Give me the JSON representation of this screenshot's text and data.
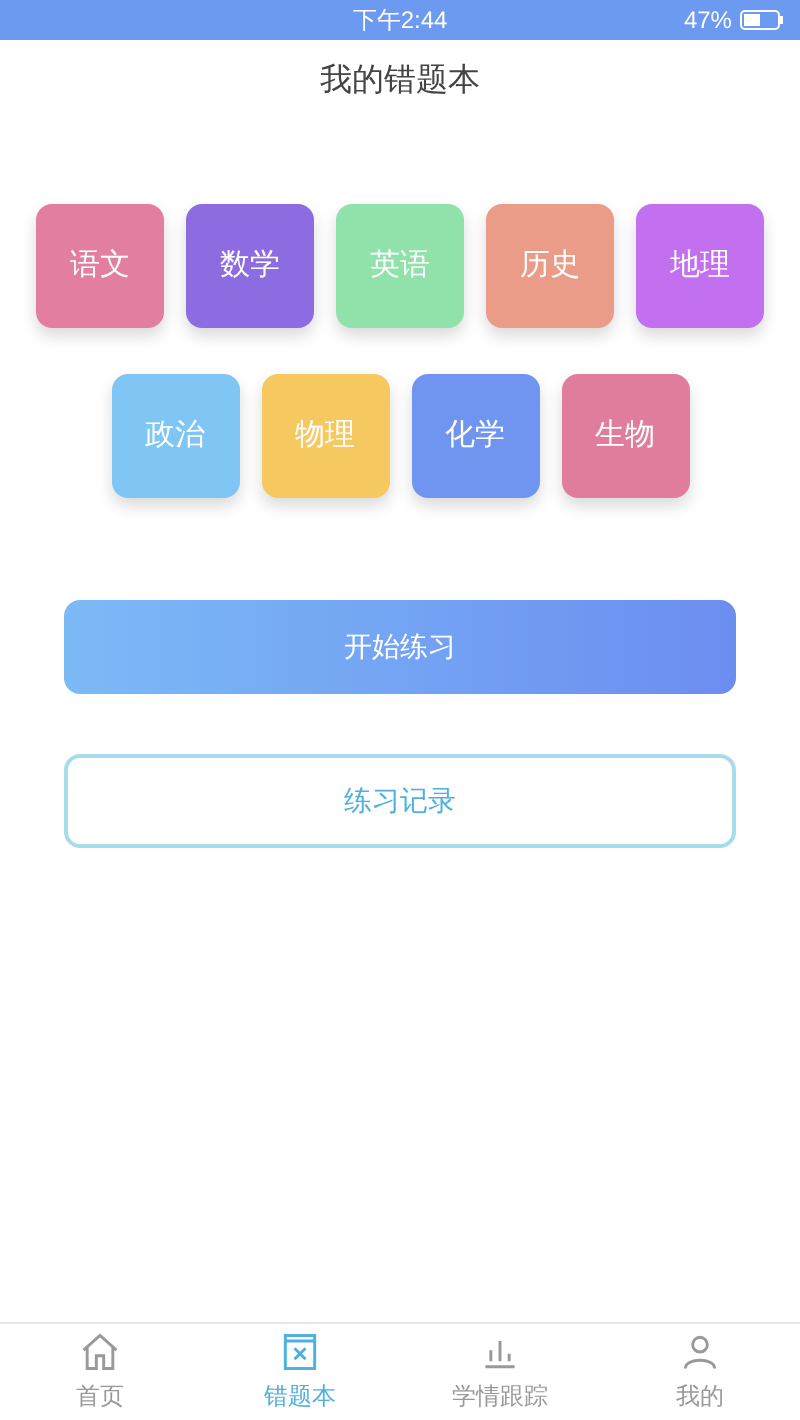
{
  "status_bar": {
    "time": "下午2:44",
    "battery": "47%"
  },
  "title": "我的错题本",
  "subjects": [
    {
      "label": "语文",
      "color": "#e27fa0"
    },
    {
      "label": "数学",
      "color": "#8d6be0"
    },
    {
      "label": "英语",
      "color": "#90e2aa"
    },
    {
      "label": "历史",
      "color": "#eb9c88"
    },
    {
      "label": "地理",
      "color": "#c26ff0"
    },
    {
      "label": "政治",
      "color": "#7fc6f5"
    },
    {
      "label": "物理",
      "color": "#f5c960"
    },
    {
      "label": "化学",
      "color": "#7095f0"
    },
    {
      "label": "生物",
      "color": "#e07c9c"
    }
  ],
  "primary_button": "开始练习",
  "secondary_button": "练习记录",
  "tabs": [
    {
      "label": "首页",
      "kind": "home",
      "selected": false
    },
    {
      "label": "错题本",
      "kind": "book",
      "selected": true
    },
    {
      "label": "学情跟踪",
      "kind": "chart",
      "selected": false
    },
    {
      "label": "我的",
      "kind": "person",
      "selected": false
    }
  ]
}
